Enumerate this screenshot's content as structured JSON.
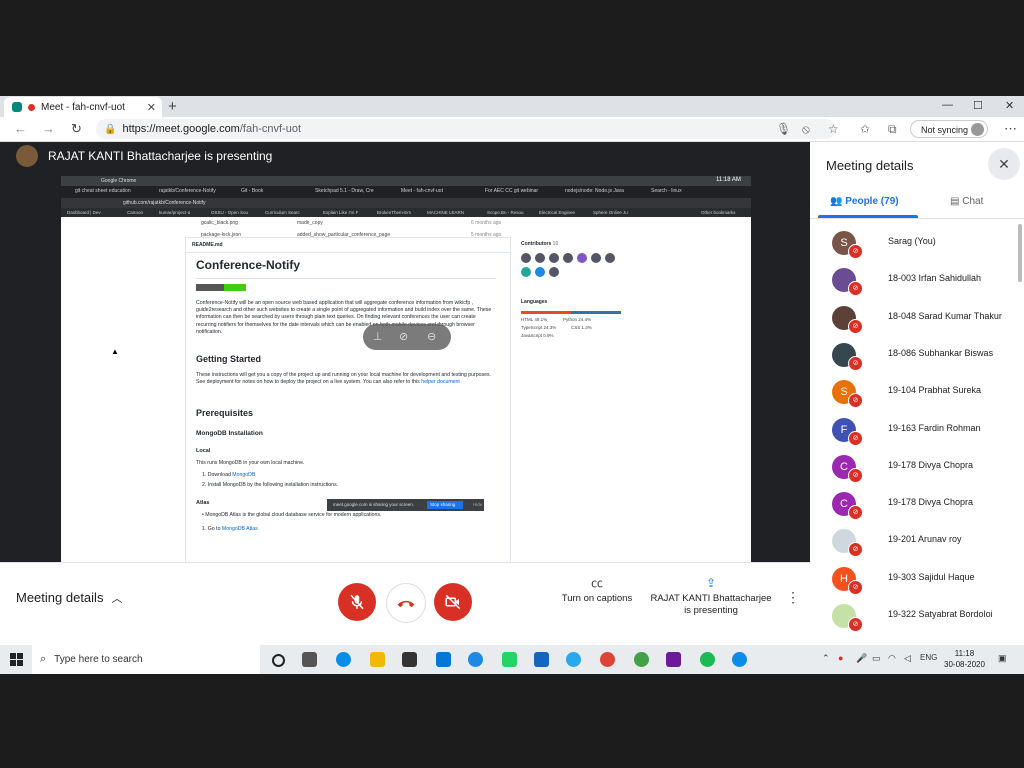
{
  "browser": {
    "tab_title": "Meet - fah-cnvf-uot",
    "tab_close": "✕",
    "new_tab": "+",
    "url_host": "https://meet.google.com",
    "url_path": "/fah-cnvf-uot",
    "sync_label": "Not syncing"
  },
  "meet": {
    "presenter_banner": "RAJAT KANTI Bhattacharjee is presenting",
    "bottom": {
      "meeting_details": "Meeting details",
      "captions_label": "Turn on captions",
      "presenting_label_1": "RAJAT KANTI Bhattacharjee",
      "presenting_label_2": "is presenting"
    }
  },
  "shared_screen": {
    "os_title": "Google Chrome",
    "os_time": "11:18 AM",
    "tabs": [
      "git cheat sheet education",
      "rajatkb/Conference-Notify",
      "Git - Book",
      "Sketchpad 5.1 - Draw, Cre",
      "Meet - fah-cnvf-uot",
      "For AEC CC git webinar",
      "nodejs/node: Node.js Java",
      "Search - linux"
    ],
    "url": "github.com/rajatkb/Conference-Notify",
    "bookmarks": [
      "Dashboard | Dev",
      "Cartoon",
      "kumar/project-a",
      "OSSU - Open Sou",
      "Curriculum Searc",
      "Explain Like I'm F",
      "BrokenThem-Em",
      "MACHINE LEARN",
      "Scope.Bn - Resou",
      "Electrical Enginee",
      "Sphere Online Ju",
      "Other bookmarks"
    ],
    "files": [
      {
        "name": "gcalic_black.png",
        "commit": "made_copy",
        "age": "6 months ago"
      },
      {
        "name": "package-lock.json",
        "commit": "added_show_particular_conference_page",
        "age": "5 months ago"
      }
    ],
    "readme_label": "README.md",
    "h1": "Conference-Notify",
    "intro": "Conference-Notify will be an open source web based application that will aggregate conference information from wikicfp , guide2research and other such websites to create a single point of aggregated information and build index over the same. These information can then be searched by users through plain text queries. On finding relevant conferences the user can create recurring notifiers for themselves for the date intervals which can be enabled on both mobile devices and through browser notification.",
    "getting_started": "Getting Started",
    "gs_text": "These instructions will get you a copy of the project up and running on your local machine for development and testing purposes. See deployment for notes on how to deploy the project on a live system. You can also refer to this",
    "gs_link": "helper document",
    "prereq": "Prerequisites",
    "mongo": "MongoDB Installation",
    "local": "Local",
    "local_text": "This runs MongoDB in your own local machine.",
    "step1": "1. Download",
    "step1_link": "MongoDB",
    "step2": "2. Install MongoDB by the following installation instructions.",
    "atlas": "Atlas",
    "atlas_text": "• MongoDB Atlas is the global cloud database service for modern applications.",
    "step_go": "1. Go to",
    "step_go_link": "MongoDB Atlas",
    "contributors": "Contributors",
    "contributors_count": "10",
    "languages": "Languages",
    "langs": [
      "HTML 49.1%",
      "Python 24.4%",
      "TypeScript 24.3%",
      "CSS 1.3%",
      "JavaScript 0.9%"
    ],
    "share_msg": "meet.google.com is sharing your screen.",
    "stop_sharing": "Stop sharing",
    "hide": "Hide"
  },
  "panel": {
    "title": "Meeting details",
    "tab_people": "People (79)",
    "tab_chat": "Chat",
    "participants": [
      {
        "name": "Sarag (You)",
        "initial": "S",
        "color": "#795548"
      },
      {
        "name": "18-003 Irfan Sahidullah",
        "initial": "",
        "color": "#6a4c93"
      },
      {
        "name": "18-048 Sarad Kumar Thakur",
        "initial": "",
        "color": "#5d4037"
      },
      {
        "name": "18-086 Subhankar Biswas",
        "initial": "",
        "color": "#37474f"
      },
      {
        "name": "19-104 Prabhat Sureka",
        "initial": "S",
        "color": "#e8710a"
      },
      {
        "name": "19-163 Fardin Rohman",
        "initial": "F",
        "color": "#3f51b5"
      },
      {
        "name": "19-178 Divya Chopra",
        "initial": "C",
        "color": "#9c27b0"
      },
      {
        "name": "19-178 Divya Chopra",
        "initial": "C",
        "color": "#9c27b0"
      },
      {
        "name": "19-201 Arunav roy",
        "initial": "",
        "color": "#cfd8dc"
      },
      {
        "name": "19-303 Sajidul Haque",
        "initial": "H",
        "color": "#f4511e"
      },
      {
        "name": "19-322 Satyabrat Bordoloi",
        "initial": "",
        "color": "#c5e1a5"
      }
    ]
  },
  "taskbar": {
    "search_placeholder": "Type here to search",
    "lang": "ENG",
    "time": "11:18",
    "date": "30-08-2020"
  },
  "colors": {
    "accent": "#1a73e8",
    "danger": "#d93025"
  }
}
